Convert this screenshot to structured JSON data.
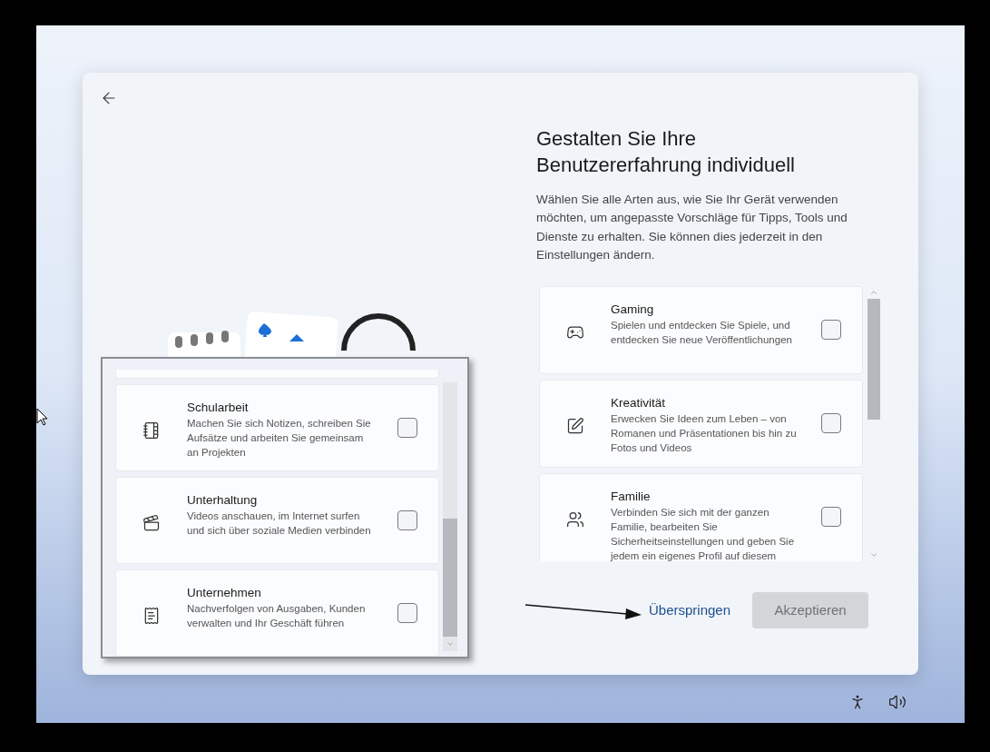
{
  "dialog": {
    "heading": "Gestalten Sie Ihre Benutzererfahrung individuell",
    "description": "Wählen Sie alle Arten aus, wie Sie Ihr Gerät verwenden möchten, um angepasste Vorschläge für Tipps, Tools und Dienste zu erhalten. Sie können dies jederzeit in den Einstellungen ändern.",
    "options": [
      {
        "kind": "gaming",
        "title": "Gaming",
        "description": "Spielen und entdecken Sie Spiele, und entdecken Sie neue Veröffentlichungen",
        "checked": false
      },
      {
        "kind": "creativity",
        "title": "Kreativität",
        "description": "Erwecken Sie Ideen zum Leben – von Romanen und Präsentationen bis hin zu Fotos und Videos",
        "checked": false
      },
      {
        "kind": "family",
        "title": "Familie",
        "description": "Verbinden Sie sich mit der ganzen Familie, bearbeiten Sie Sicherheitseinstellungen und geben Sie jedem ein eigenes Profil auf diesem",
        "checked": false
      }
    ],
    "skip_link": "Überspringen",
    "accept_button": {
      "label": "Akzeptieren",
      "disabled": true
    }
  },
  "inset": {
    "options": [
      {
        "kind": "school",
        "title": "Schularbeit",
        "description": "Machen Sie sich Notizen, schreiben Sie Aufsätze und arbeiten Sie gemeinsam an Projekten",
        "checked": false
      },
      {
        "kind": "entertainment",
        "title": "Unterhaltung",
        "description": "Videos anschauen, im Internet surfen und sich über soziale Medien verbinden",
        "checked": false
      },
      {
        "kind": "business",
        "title": "Unternehmen",
        "description": "Nachverfolgen von Ausgaben, Kunden verwalten und Ihr Geschäft führen",
        "checked": false
      }
    ]
  }
}
